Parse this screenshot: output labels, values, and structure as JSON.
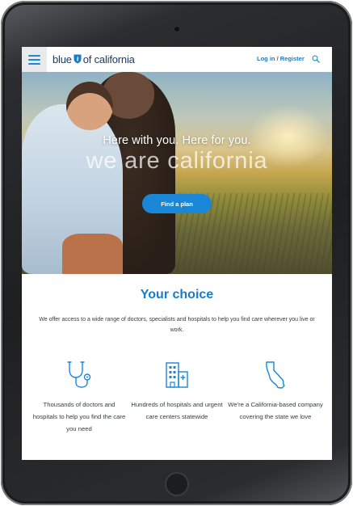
{
  "header": {
    "logo_text_left": "blue",
    "logo_text_right": "of california",
    "login_label": "Log in / Register",
    "menu_icon": "hamburger-icon",
    "search_icon": "search-icon"
  },
  "hero": {
    "title": "Here with you. Here for you.",
    "subtitle": "we are california",
    "cta_label": "Find a plan"
  },
  "main": {
    "section_title": "Your choice",
    "description": "We offer access to a wide range of doctors, specialists and hospitals to help you find care wherever you live or work.",
    "features": [
      {
        "icon": "stethoscope-icon",
        "text": "Thousands of doctors and hospitals to help you find the care you need"
      },
      {
        "icon": "hospital-building-icon",
        "text": "Hundreds of hospitals and urgent care centers statewide"
      },
      {
        "icon": "california-map-icon",
        "text": "We're a California-based company covering the state we love"
      }
    ]
  },
  "colors": {
    "brand_blue": "#1a7cc4",
    "cta_blue": "#1a86d8",
    "logo_navy": "#1b3a63",
    "device_body": "#1e1f21"
  }
}
